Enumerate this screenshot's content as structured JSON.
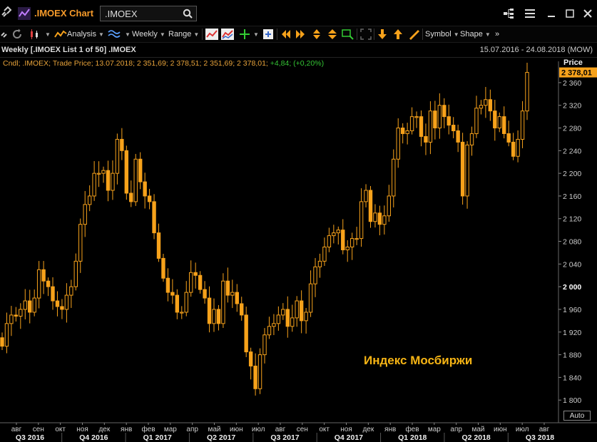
{
  "window": {
    "title": ".IMOEX Chart",
    "search_value": ".IMOEX"
  },
  "toolbar": {
    "analysis_label": "Analysis",
    "interval_label": "Weekly",
    "range_label": "Range",
    "symbol_label": "Symbol",
    "shape_label": "Shape"
  },
  "header": {
    "title": "Weekly [.IMOEX List 1 of 50] .IMOEX",
    "date_range": "15.07.2016 - 24.08.2018 (MOW)"
  },
  "legend": {
    "prefix": "Cndl; .IMOEX; Trade Price; 13.07.2018; 2 351,69; 2 378,51; 2 351,69; 2 378,01;",
    "change": "+4,84; (+0,20%)"
  },
  "annotation": "Индекс Мосбиржи",
  "price_axis": {
    "title": "Price",
    "last_price": "2 378,01",
    "auto_label": "Auto"
  },
  "colors": {
    "candle": "#f7a21b",
    "last_price_bg": "#f7a21b",
    "grid": "#2a2a2a",
    "annotation": "#f6b414"
  },
  "chart_data": {
    "type": "candlestick",
    "interval": "weekly",
    "ylim": [
      1760,
      2380
    ],
    "y_ticks": [
      "1 800",
      "1 840",
      "1 880",
      "1 920",
      "1 960",
      "2 000",
      "2 040",
      "2 080",
      "2 120",
      "2 160",
      "2 200",
      "2 240",
      "2 280",
      "2 320",
      "2 360"
    ],
    "y_tick_values": [
      1800,
      1840,
      1880,
      1920,
      1960,
      2000,
      2040,
      2080,
      2120,
      2160,
      2200,
      2240,
      2280,
      2320,
      2360
    ],
    "bold_ticks": [
      "2 000"
    ],
    "months": [
      "авг",
      "сен",
      "окт",
      "ноя",
      "дек",
      "янв",
      "фев",
      "мар",
      "апр",
      "май",
      "июн",
      "июл",
      "авг",
      "сен",
      "окт",
      "ноя",
      "дек",
      "янв",
      "фев",
      "мар",
      "апр",
      "май",
      "июн",
      "июл",
      "авг"
    ],
    "quarters": [
      "Q3 2016",
      "Q4 2016",
      "Q1 2017",
      "Q2 2017",
      "Q3 2017",
      "Q4 2017",
      "Q1 2018",
      "Q2 2018",
      "Q3 2018"
    ],
    "closes": [
      1895,
      1935,
      1950,
      1948,
      1960,
      1975,
      1955,
      1980,
      2030,
      2010,
      2000,
      1975,
      1965,
      1960,
      1985,
      2000,
      2045,
      2110,
      2145,
      2160,
      2200,
      2200,
      2205,
      2170,
      2200,
      2260,
      2240,
      2165,
      2150,
      2225,
      2185,
      2160,
      2150,
      2095,
      2050,
      2015,
      1990,
      1985,
      1955,
      1955,
      1990,
      2025,
      2020,
      1995,
      1980,
      1935,
      1960,
      1935,
      2010,
      1985,
      1990,
      1970,
      1950,
      1885,
      1860,
      1820,
      1880,
      1915,
      1930,
      1935,
      1950,
      1960,
      1930,
      1945,
      1975,
      1940,
      1955,
      2005,
      2035,
      2045,
      2070,
      2090,
      2095,
      2100,
      2065,
      2070,
      2085,
      2085,
      2150,
      2170,
      2115,
      2130,
      2110,
      2125,
      2160,
      2225,
      2280,
      2270,
      2275,
      2300,
      2300,
      2265,
      2255,
      2310,
      2280,
      2320,
      2300,
      2285,
      2275,
      2255,
      2160,
      2250,
      2270,
      2315,
      2320,
      2330,
      2310,
      2280,
      2300,
      2270,
      2255,
      2230,
      2260,
      2310,
      2378
    ]
  }
}
